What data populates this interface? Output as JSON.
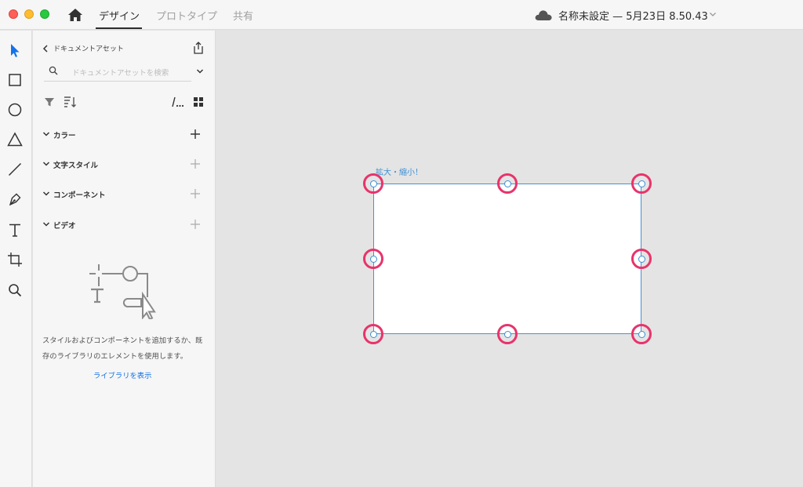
{
  "titlebar": {
    "tabs": [
      "デザイン",
      "プロトタイプ",
      "共有"
    ],
    "document_title": "名称未設定 — 5月23日 8.50.43"
  },
  "toolbar": {
    "tools": [
      "select-tool",
      "rectangle-tool",
      "ellipse-tool",
      "triangle-tool",
      "line-tool",
      "pen-tool",
      "text-tool",
      "artboard-tool",
      "zoom-tool"
    ]
  },
  "assets_panel": {
    "title": "ドキュメントアセット",
    "search_placeholder": "ドキュメントアセットを検索",
    "sections": [
      "カラー",
      "文字スタイル",
      "コンポーネント",
      "ビデオ"
    ],
    "empty_message": "スタイルおよびコンポーネントを追加するか、既存のライブラリのエレメントを使用します。",
    "library_link": "ライブラリを表示"
  },
  "canvas": {
    "annotation": "拡大・縮小！",
    "colors": {
      "selection": "#4d8fcf",
      "highlight_ring": "#e8336b"
    }
  }
}
